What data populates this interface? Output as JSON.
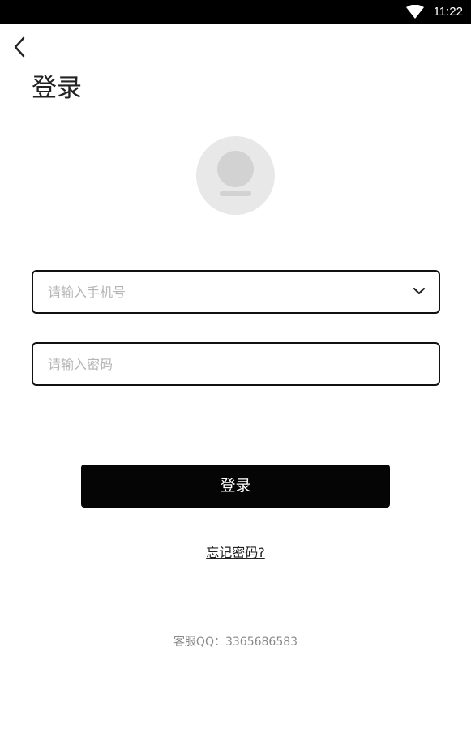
{
  "status_bar": {
    "time": "11:22",
    "wifi_icon": "wifi-icon"
  },
  "header": {
    "back_icon": "chevron-left-icon",
    "title": "登录"
  },
  "avatar": {
    "icon": "user-avatar-icon"
  },
  "form": {
    "phone_placeholder": "请输入手机号",
    "phone_value": "",
    "phone_dropdown_icon": "chevron-down-icon",
    "password_placeholder": "请输入密码",
    "password_value": ""
  },
  "actions": {
    "login_label": "登录",
    "forgot_label": "忘记密码?"
  },
  "footer": {
    "support_text": "客服QQ：3365686583"
  }
}
